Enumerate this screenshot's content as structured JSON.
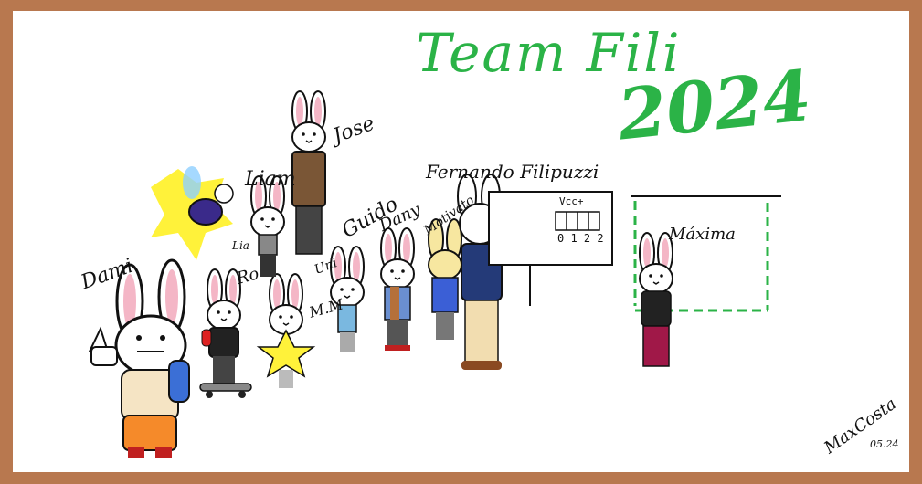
{
  "drawing": {
    "title": "Team Fili",
    "year": "2024",
    "names": {
      "dami": "Dami",
      "lia": "Lia",
      "liam": "Liam",
      "jose": "Jose",
      "ro": "Ro",
      "mm": "M.M",
      "uni": "Uni",
      "guido": "Guido",
      "dany": "Dany",
      "motivato": "Motivato",
      "fernando": "Fernando Filipuzzi",
      "maxima": "Máxima"
    },
    "whiteboard_text": {
      "vcc": "Vcc+",
      "digits": "0 1 2 2"
    },
    "signature": "MaxCosta",
    "date": "05.24",
    "colors": {
      "frame": "#b8784f",
      "title_green": "#2bb347",
      "bunny_pink": "#f4b6c6",
      "outline": "#111111"
    }
  }
}
